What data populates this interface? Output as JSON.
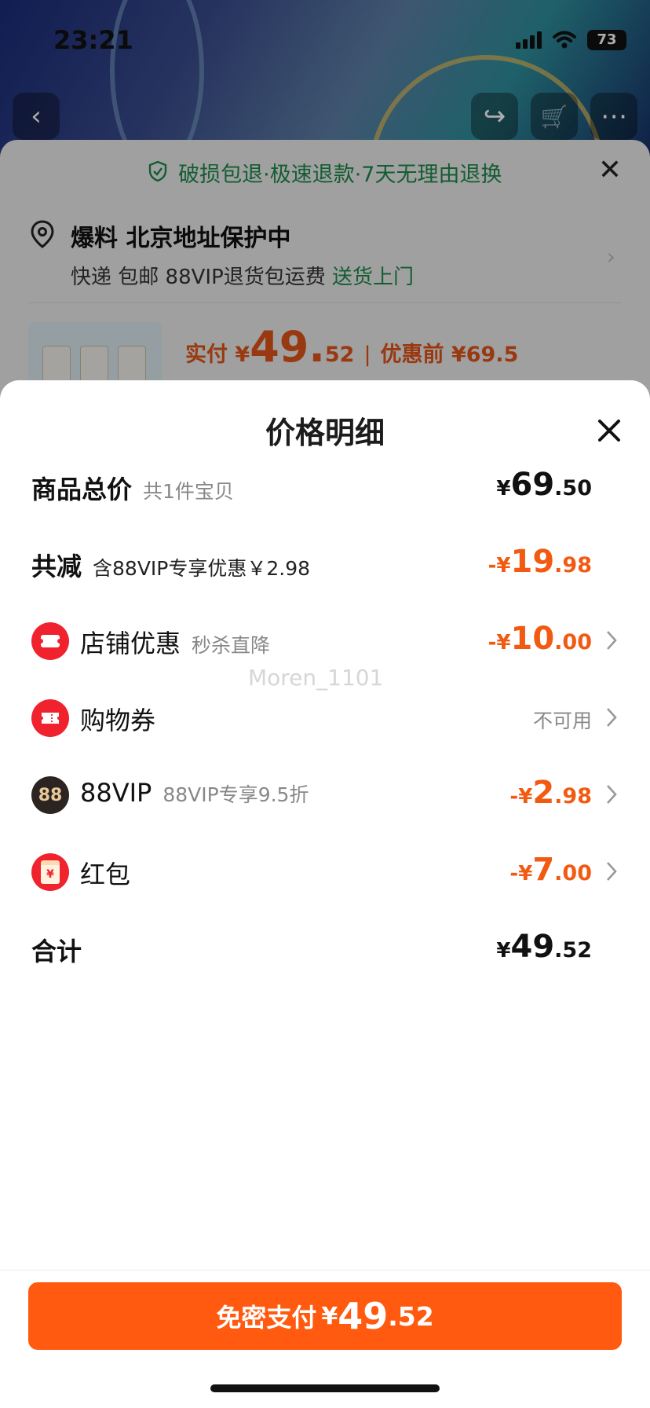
{
  "status": {
    "time": "23:21",
    "battery": "73"
  },
  "background": {
    "guarantee": "破损包退·极速退款·7天无理由退换",
    "address_title": "爆料 北京地址保护中",
    "delivery_prefix": "快递 包邮 88VIP退货包运费",
    "delivery_link": "送货上门",
    "pay_label": "实付 ¥",
    "pay_int": "49.",
    "pay_dec": "52",
    "before_label": "优惠前 ¥69.5"
  },
  "sheet": {
    "title": "价格明细",
    "rows": [
      {
        "label": "商品总价",
        "sub": "共1件宝贝",
        "yen": "¥",
        "int": "69",
        "dec": ".50"
      },
      {
        "label": "共减",
        "sub": "含88VIP专享优惠￥2.98",
        "yen": "-¥",
        "int": "19",
        "dec": ".98"
      },
      {
        "label": "店铺优惠",
        "sub": "秒杀直降",
        "yen": "-¥",
        "int": "10",
        "dec": ".00",
        "icon": "shop-coupon-icon"
      },
      {
        "label": "购物券",
        "sub": "",
        "status": "不可用",
        "icon": "ticket-icon"
      },
      {
        "label": "88VIP",
        "sub": "88VIP专享9.5折",
        "yen": "-¥",
        "int": "2",
        "dec": ".98",
        "icon": "vip88-icon",
        "icon_text": "88"
      },
      {
        "label": "红包",
        "sub": "",
        "yen": "-¥",
        "int": "7",
        "dec": ".00",
        "icon": "red-packet-icon",
        "icon_text": "¥"
      },
      {
        "label": "合计",
        "sub": "",
        "yen": "¥",
        "int": "49",
        "dec": ".52"
      }
    ],
    "watermark": "Moren_1101"
  },
  "footer": {
    "pay_label": "免密支付",
    "yen": "¥",
    "int": "49",
    "dec": ".52"
  },
  "colors": {
    "accent": "#ff5a0f",
    "discount": "#f25a12",
    "green": "#1c8a4a"
  }
}
